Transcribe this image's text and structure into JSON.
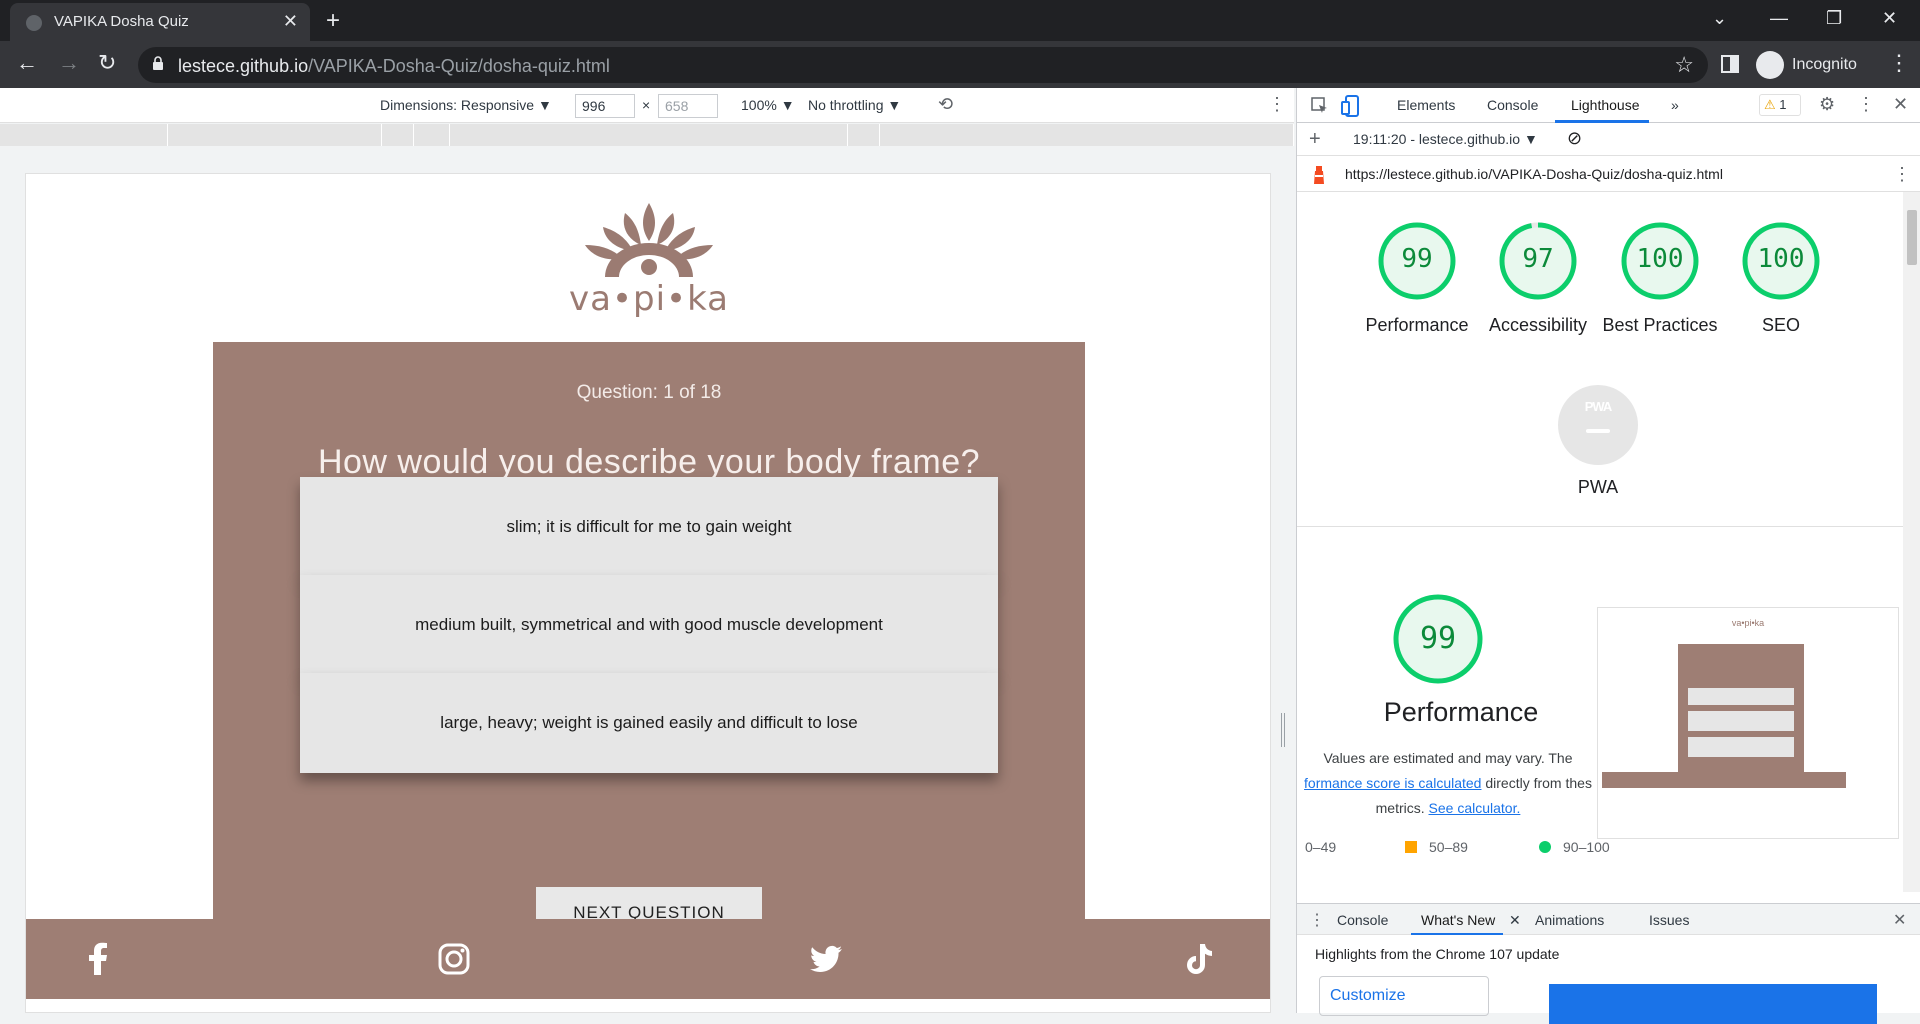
{
  "browser": {
    "tab_title": "VAPIKA Dosha Quiz",
    "new_tab": "+",
    "url_host": "lestece.github.io",
    "url_path": "/VAPIKA-Dosha-Quiz/dosha-quiz.html",
    "profile_label": "Incognito"
  },
  "device_toolbar": {
    "dimensions_label": "Dimensions: Responsive ▼",
    "width": "996",
    "height_placeholder": "658",
    "times": "×",
    "zoom": "100% ▼",
    "throttling": "No throttling ▼"
  },
  "page": {
    "brand": "va•pi•ka",
    "question_counter": "Question: 1 of 18",
    "question": "How would you describe your body frame?",
    "answers": [
      "slim; it is difficult for me to gain weight",
      "medium built, symmetrical and with good muscle development",
      "large, heavy; weight is gained easily and difficult to lose"
    ],
    "next_button": "NEXT QUESTION",
    "socials": [
      "facebook-icon",
      "instagram-icon",
      "twitter-icon",
      "tiktok-icon"
    ],
    "colors": {
      "brand": "#9e7e74",
      "answer_bg": "#e6e6e6"
    }
  },
  "devtools": {
    "tabs": [
      "Elements",
      "Console",
      "Lighthouse",
      "»"
    ],
    "active_tab": "Lighthouse",
    "warning_count": "1",
    "report_time": "19:11:20 - lestece.github.io ▼",
    "report_url": "https://lestece.github.io/VAPIKA-Dosha-Quiz/dosha-quiz.html",
    "scores": [
      {
        "value": "99",
        "label": "Performance"
      },
      {
        "value": "97",
        "label": "Accessibility"
      },
      {
        "value": "100",
        "label": "Best Practices"
      },
      {
        "value": "100",
        "label": "SEO"
      }
    ],
    "pwa": {
      "badge": "PWA",
      "label": "PWA"
    },
    "performance": {
      "score": "99",
      "title": "Performance",
      "note_1": "Values are estimated and may vary. The",
      "note_link": "formance score is calculated",
      "note_2": " directly from thes",
      "note_3": "metrics. ",
      "note_link2": "See calculator."
    },
    "legend": {
      "bad": "0–49",
      "avg": "50–89",
      "good": "90–100"
    },
    "drawer_tabs": [
      "Console",
      "What's New",
      "Animations",
      "Issues"
    ],
    "drawer_active": "What's New",
    "highlights": "Highlights from the Chrome 107 update",
    "customize": "Customize",
    "colors": {
      "good": "#0cce6b",
      "avg": "#ffa400",
      "link": "#1a73e8"
    }
  }
}
